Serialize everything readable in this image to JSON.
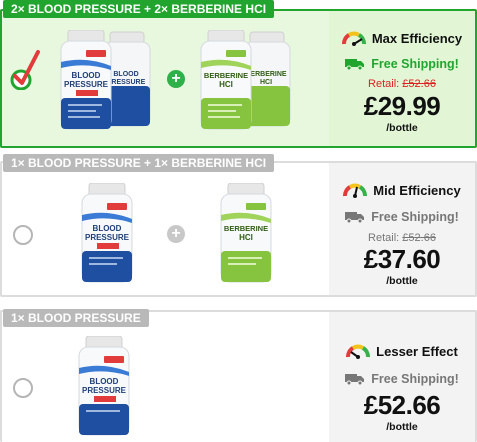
{
  "offers": [
    {
      "tag": "2× BLOOD PRESSURE + 2× BERBERINE HCI",
      "selected": true,
      "efficiency": "Max Efficiency",
      "shipping": "Free Shipping!",
      "retail_label": "Retail:",
      "retail_price": "£52.66",
      "price": "£29.99",
      "per": "/bottle",
      "bottles_left": {
        "brand": "EVERLASTING",
        "line1": "BLOOD",
        "line2": "PRESSURE",
        "dose": "250 MG"
      },
      "bottles_right": {
        "brand": "EVERLASTING",
        "line1": "BERBERINE",
        "line2": "HCI",
        "dose": "500 MG"
      }
    },
    {
      "tag": "1× BLOOD PRESSURE + 1× BERBERINE HCI",
      "selected": false,
      "efficiency": "Mid Efficiency",
      "shipping": "Free Shipping!",
      "retail_label": "Retail:",
      "retail_price": "£52.66",
      "price": "£37.60",
      "per": "/bottle"
    },
    {
      "tag": "1× BLOOD PRESSURE",
      "selected": false,
      "efficiency": "Lesser Effect",
      "shipping": "Free Shipping!",
      "price": "£52.66",
      "per": "/bottle"
    }
  ],
  "colors": {
    "selected_green": "#22a52f",
    "selected_bg": "#e8f8df",
    "panel_bg": "#f3f3f3",
    "unselected_tag": "#b9b9b9",
    "ship_gray": "#777777",
    "retail_red": "#e02020"
  },
  "icons": [
    "check-icon",
    "plus-icon",
    "gauge-icon",
    "truck-icon",
    "bottle-icon"
  ]
}
